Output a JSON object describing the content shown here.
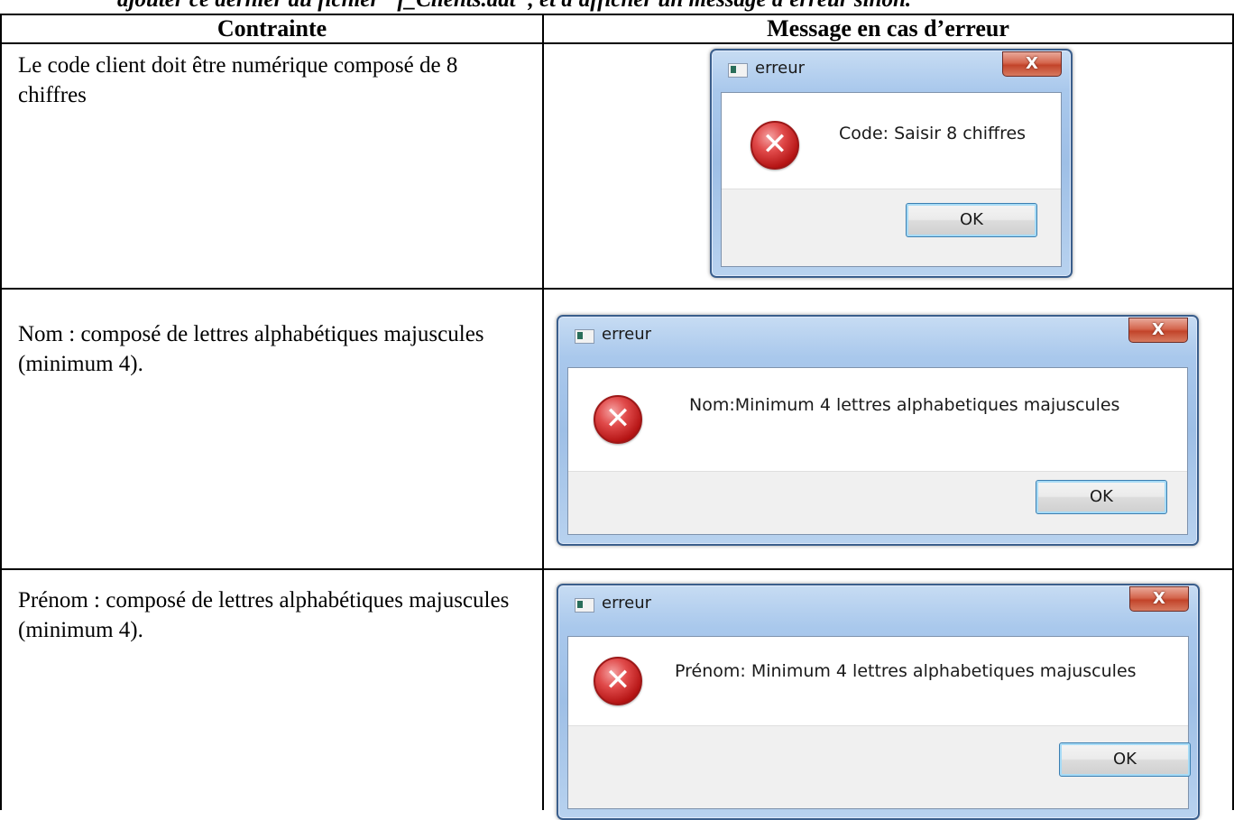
{
  "document": {
    "intro_text": "ajouter ce dernier au fichier \"f_Clients.dat\", et d'afficher un message d'erreur sinon."
  },
  "table": {
    "headers": [
      "Contrainte",
      "Message  en cas d’erreur"
    ],
    "rows": [
      {
        "constraint": "Le code client doit être numérique composé de 8 chiffres",
        "dialog": {
          "title": "erreur",
          "close": "X",
          "message": "Code: Saisir 8 chiffres",
          "button": "OK"
        }
      },
      {
        "constraint": "Nom : composé de lettres alphabétiques majuscules (minimum 4).",
        "dialog": {
          "title": "erreur",
          "close": "X",
          "message": "Nom:Minimum 4 lettres alphabetiques majuscules",
          "button": "OK"
        }
      },
      {
        "constraint": "Prénom : composé de lettres alphabétiques majuscules (minimum 4).",
        "dialog": {
          "title": "erreur",
          "close": "X",
          "message": "Prénom: Minimum 4 lettres alphabetiques majuscules",
          "button": "OK"
        }
      }
    ]
  },
  "icons": {
    "error": "error-circle-icon",
    "app": "application-icon"
  },
  "colors": {
    "error_red": "#c2281c",
    "dialog_frame": "#9ebfe6",
    "close_red": "#c2442a"
  }
}
